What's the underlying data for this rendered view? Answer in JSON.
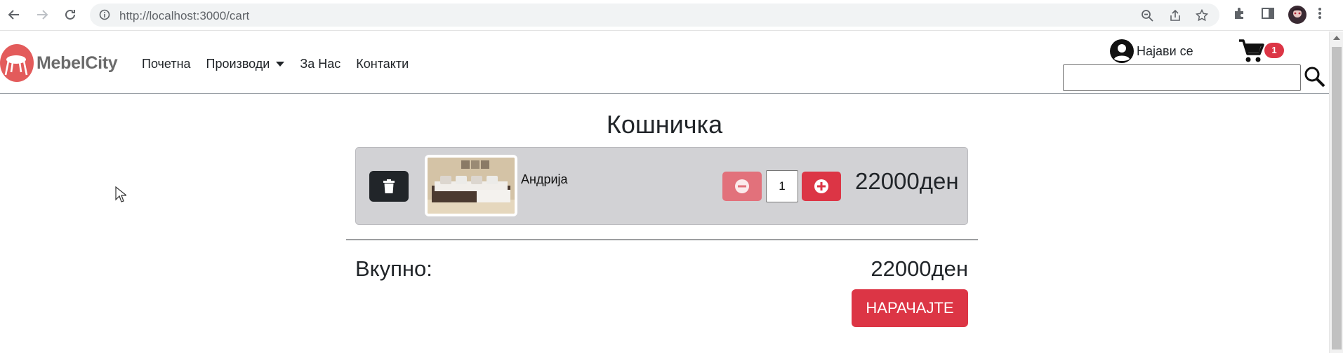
{
  "browser": {
    "url": "http://localhost:3000/cart",
    "icons": [
      "back-icon",
      "forward-icon",
      "reload-icon",
      "info-icon",
      "zoom-icon",
      "share-icon",
      "star-icon",
      "extensions-icon",
      "sidepanel-icon",
      "profile-avatar",
      "menu-icon"
    ]
  },
  "navbar": {
    "brand": "MebelCity",
    "links": [
      "Почетна",
      "Производи",
      "За Нас",
      "Контакти"
    ],
    "login_label": "Најави се",
    "cart_count": "1",
    "search_placeholder": ""
  },
  "cart": {
    "title": "Кошничка",
    "items": [
      {
        "name": "Андрија",
        "quantity": "1",
        "price": "22000ден"
      }
    ],
    "total_label": "Вкупно:",
    "total_value": "22000ден",
    "order_button": "НАРАЧАЈТЕ"
  },
  "colors": {
    "accent": "#dc3545",
    "accent_disabled": "#e2717b",
    "dark_button": "#212529",
    "row_background": "#d2d2d5"
  }
}
